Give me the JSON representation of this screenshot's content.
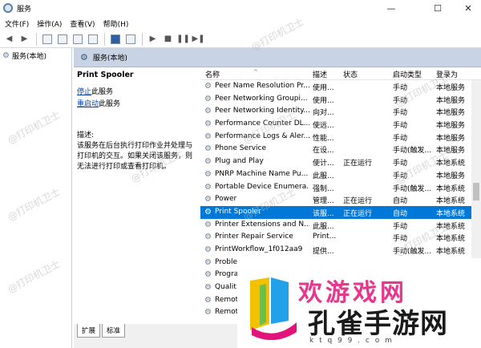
{
  "window": {
    "title": "服务",
    "minimize": "—",
    "maximize": "☐",
    "close": "✕"
  },
  "menu": [
    "文件(F)",
    "操作(A)",
    "查看(V)",
    "帮助(H)"
  ],
  "tree": {
    "item": "服务(本地)"
  },
  "header": {
    "title": "服务(本地)"
  },
  "detail": {
    "service_name": "Print Spooler",
    "stop_link": "停止",
    "stop_suffix": "此服务",
    "restart_link": "重启动",
    "restart_suffix": "此服务",
    "desc_label": "描述:",
    "desc_text": "该服务在后台执行打印作业并处理与打印机的交互。如果关闭该服务，则无法进行打印或查看打印机。"
  },
  "columns": {
    "name": "名称",
    "desc": "描述",
    "status": "状态",
    "startup": "启动类型",
    "logon": "登录为"
  },
  "rows": [
    {
      "name": "Peer Name Resolution Pr...",
      "desc": "使用...",
      "status": "",
      "startup": "手动",
      "logon": "本地服务"
    },
    {
      "name": "Peer Networking Groupi...",
      "desc": "使用...",
      "status": "",
      "startup": "手动",
      "logon": "本地服务"
    },
    {
      "name": "Peer Networking Identity...",
      "desc": "向对...",
      "status": "",
      "startup": "手动",
      "logon": "本地服务"
    },
    {
      "name": "Performance Counter DL...",
      "desc": "使远...",
      "status": "",
      "startup": "手动",
      "logon": "本地服务"
    },
    {
      "name": "Performance Logs & Aler...",
      "desc": "性能...",
      "status": "",
      "startup": "手动",
      "logon": "本地服务"
    },
    {
      "name": "Phone Service",
      "desc": "在设...",
      "status": "",
      "startup": "手动(触发...",
      "logon": "本地服务"
    },
    {
      "name": "Plug and Play",
      "desc": "使计...",
      "status": "正在运行",
      "startup": "手动",
      "logon": "本地系统"
    },
    {
      "name": "PNRP Machine Name Pu...",
      "desc": "此服...",
      "status": "",
      "startup": "手动",
      "logon": "本地服务"
    },
    {
      "name": "Portable Device Enumera...",
      "desc": "强制...",
      "status": "",
      "startup": "手动(触发...",
      "logon": "本地系统"
    },
    {
      "name": "Power",
      "desc": "管理...",
      "status": "正在运行",
      "startup": "自动",
      "logon": "本地系统"
    },
    {
      "name": "Print Spooler",
      "desc": "该服...",
      "status": "正在运行",
      "startup": "自动",
      "logon": "本地系统"
    },
    {
      "name": "Printer Extensions and N...",
      "desc": "此服...",
      "status": "",
      "startup": "手动",
      "logon": "本地系统"
    },
    {
      "name": "Printer Repair Service",
      "desc": "Print...",
      "status": "",
      "startup": "手动",
      "logon": "本地系统"
    },
    {
      "name": "PrintWorkflow_1f012aa9",
      "desc": "提供...",
      "status": "",
      "startup": "手动(触发...",
      "logon": "本地系统"
    },
    {
      "name": "Proble...",
      "desc": "",
      "status": "",
      "startup": "",
      "logon": "本地系统"
    },
    {
      "name": "Progra...",
      "desc": "",
      "status": "",
      "startup": "",
      "logon": ""
    },
    {
      "name": "Qualit...",
      "desc": "",
      "status": "",
      "startup": "",
      "logon": ""
    },
    {
      "name": "Remot...",
      "desc": "",
      "status": "",
      "startup": "",
      "logon": ""
    },
    {
      "name": "Remot...",
      "desc": "",
      "status": "",
      "startup": "",
      "logon": ""
    }
  ],
  "selected_row": 10,
  "tabs": [
    "扩展",
    "标准"
  ],
  "watermark": "@打印机卫士",
  "logo": {
    "top_text": "欢游戏网",
    "main_text": "孔雀手游网",
    "sub_text": "k t q 9 9 . c o m"
  },
  "colors": {
    "selection": "#0078d7",
    "header_bg": "#c8d4e3",
    "link": "#0645ad"
  }
}
